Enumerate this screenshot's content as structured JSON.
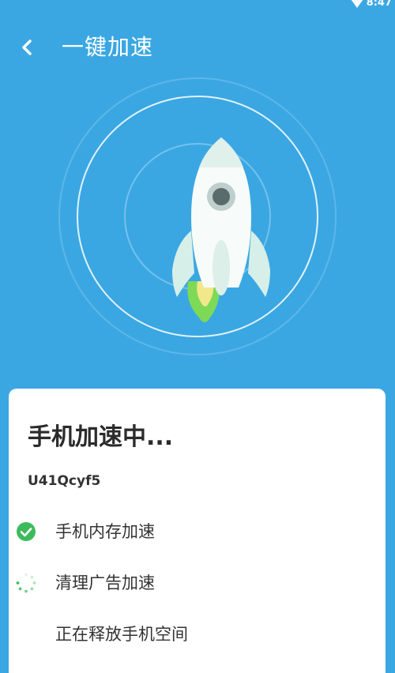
{
  "status_bar": {
    "time": "8:47",
    "icons": [
      "wifi-icon"
    ]
  },
  "app_bar": {
    "title": "一键加速",
    "back_icon": "chevron-left-icon"
  },
  "hero": {
    "illustration": "rocket-icon",
    "colors": {
      "background": "#3aa7e3",
      "rings": "#ffffff",
      "flame": "#7ed957"
    }
  },
  "card": {
    "title": "手机加速中...",
    "subtitle": "U41Qcyf5",
    "tasks": [
      {
        "label": "手机内存加速",
        "status": "done",
        "icon": "check-circle-icon"
      },
      {
        "label": "清理广告加速",
        "status": "in-progress",
        "icon": "loading-spinner-icon"
      },
      {
        "label": "正在释放手机空间",
        "status": "pending",
        "icon": ""
      }
    ],
    "colors": {
      "done": "#3dbb5c",
      "spinner": "#3dbb5c"
    }
  }
}
